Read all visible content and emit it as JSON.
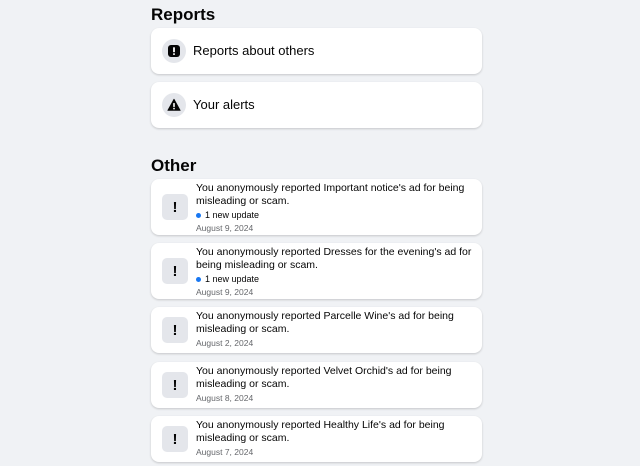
{
  "reports": {
    "title": "Reports",
    "items": [
      {
        "label": "Reports about others",
        "icon": "exclamation-square-icon"
      },
      {
        "label": "Your alerts",
        "icon": "warning-triangle-icon"
      }
    ]
  },
  "other": {
    "title": "Other",
    "items": [
      {
        "text": "You anonymously reported Important notice's ad for being misleading or scam.",
        "update": "1 new update",
        "date": "August 9, 2024"
      },
      {
        "text": "You anonymously reported Dresses for the evening's ad for being misleading or scam.",
        "update": "1 new update",
        "date": "August 9, 2024"
      },
      {
        "text": "You anonymously reported Parcelle Wine's ad for being misleading or scam.",
        "date": "August 2, 2024"
      },
      {
        "text": "You anonymously reported Velvet Orchid's ad for being misleading or scam.",
        "date": "August 8, 2024"
      },
      {
        "text": "You anonymously reported Healthy Life's ad for being misleading or scam.",
        "date": "August 7, 2024"
      }
    ]
  },
  "icons": {
    "notice_glyph": "!"
  },
  "colors": {
    "background": "#f0f2f5",
    "card": "#ffffff",
    "icon_bg": "#e4e6eb",
    "unread_dot": "#1877f2",
    "secondary_text": "#65676b"
  }
}
